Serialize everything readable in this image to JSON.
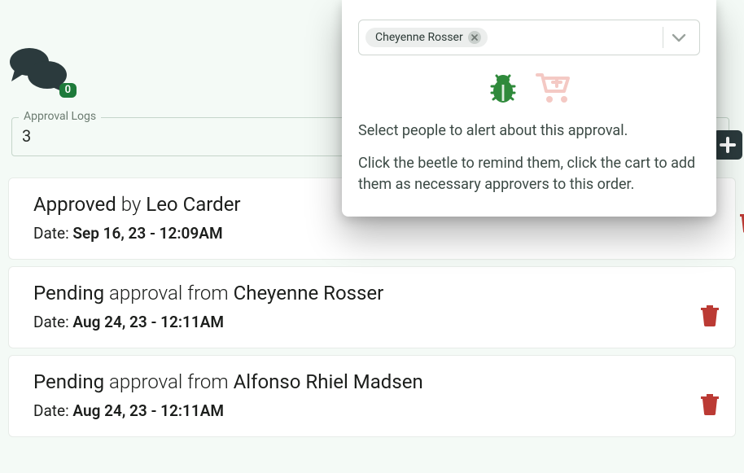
{
  "chat": {
    "badge_count": "0"
  },
  "approval_logs": {
    "legend": "Approval Logs",
    "count": "3"
  },
  "logs": [
    {
      "status": "Approved",
      "connector": "by",
      "name": "Leo Carder",
      "date_label": "Date:",
      "date_value": "Sep 16, 23 - 12:09AM",
      "trash_shifted": true
    },
    {
      "status": "Pending",
      "connector": "approval from",
      "name": "Cheyenne Rosser",
      "date_label": "Date:",
      "date_value": "Aug 24, 23 - 12:11AM",
      "trash_shifted": false
    },
    {
      "status": "Pending",
      "connector": "approval from",
      "name": "Alfonso Rhiel Madsen",
      "date_label": "Date:",
      "date_value": "Aug 24, 23 - 12:11AM",
      "trash_shifted": false
    }
  ],
  "popover": {
    "chip_name": "Cheyenne Rosser",
    "para1": "Select people to alert about this approval.",
    "para2": "Click the beetle to remind them, click the cart to add them as necessary approvers to this order."
  }
}
